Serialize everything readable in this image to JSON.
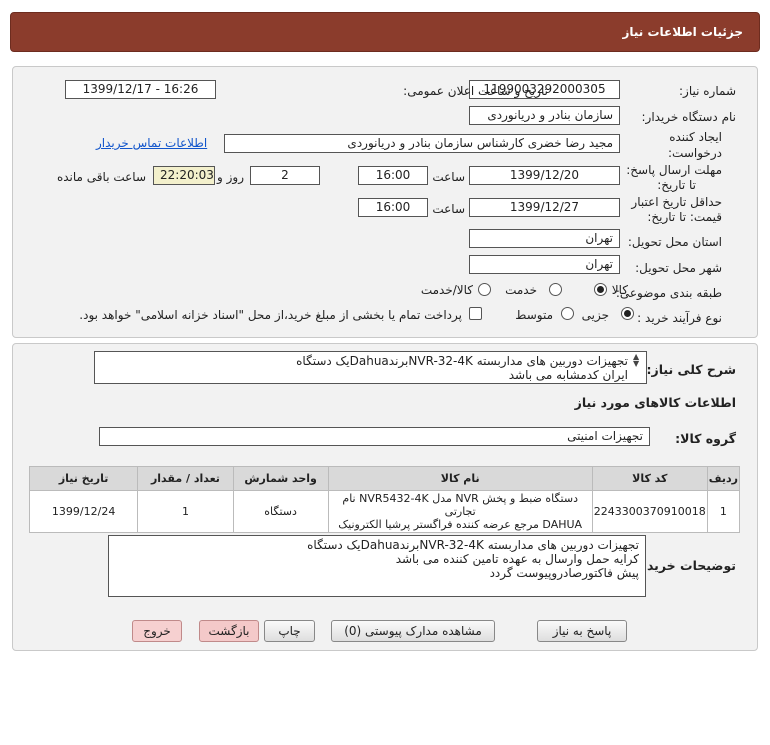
{
  "header": {
    "title": "جزئیات اطلاعات نیاز"
  },
  "info": {
    "need_number_label": "شماره نیاز:",
    "need_number": "1199003292000305",
    "announce_label": "تاریخ و ساعت اعلان عمومی:",
    "announce_value": "1399/12/17 - 16:26",
    "buyer_org_label": "نام دستگاه خریدار:",
    "buyer_org": "سازمان بنادر و دریانوردی",
    "creator_label_1": "ایجاد کننده",
    "creator_label_2": "درخواست:",
    "creator": "مجید رضا خضری کارشناس سازمان بنادر و دریانوردی",
    "contact_link": "اطلاعات تماس خریدار",
    "reply_deadline_label_1": "مهلت ارسال پاسخ:",
    "reply_deadline_label_2": "تا تاریخ:",
    "reply_date": "1399/12/20",
    "time_label": "ساعت",
    "reply_time": "16:00",
    "days_value": "2",
    "days_label": "روز و",
    "remaining_time": "22:20:03",
    "remaining_label": "ساعت باقی مانده",
    "validity_label_1": "حداقل تاریخ اعتبار",
    "validity_label_2": "قیمت: تا تاریخ:",
    "validity_date": "1399/12/27",
    "validity_time_label": "ساعت",
    "validity_time": "16:00",
    "province_label": "استان محل تحویل:",
    "province": "تهران",
    "city_label": "شهر محل تحویل:",
    "city": "تهران",
    "category_label": "طبقه بندی موضوعی:",
    "category_options": [
      "کالا",
      "خدمت",
      "کالا/خدمت"
    ],
    "category_selected": "کالا",
    "process_label": "نوع فرآیند خرید :",
    "process_options": [
      "جزیی",
      "متوسط"
    ],
    "process_selected": "جزیی",
    "payment_note": "پرداخت تمام یا بخشی از مبلغ خرید،از محل \"اسناد خزانه اسلامی\" خواهد بود."
  },
  "details": {
    "summary_label": "شرح کلی نیاز:",
    "summary_lines": [
      "تجهیزات دوربین های مداربسته NVR-32-4KبرندDahuaیک دستگاه",
      "ایران کدمشابه می باشد"
    ],
    "goods_info_title": "اطلاعات کالاهای مورد نیاز",
    "goods_group_label": "گروه کالا:",
    "goods_group": "تجهیزات امنیتی",
    "table": {
      "headers": [
        "ردیف",
        "کد کالا",
        "نام کالا",
        "واحد شمارش",
        "تعداد / مقدار",
        "تاریخ نیاز"
      ],
      "rows": [
        {
          "row": "1",
          "code": "2243300370910018",
          "name_line1": "دستگاه ضبط و پخش NVR مدل NVR5432-4K نام تجارتی",
          "name_line2": "DAHUA مرجع عرضه کننده فراگستر پرشیا الکترونیک",
          "unit": "دستگاه",
          "qty": "1",
          "date": "1399/12/24"
        }
      ]
    },
    "buyer_notes_label": "توضیحات خریدار:",
    "buyer_notes_lines": [
      "تجهیزات دوربین های مداربسته NVR-32-4KبرندDahuaیک دستگاه",
      "کرایه حمل وارسال به عهده تامین کننده می باشد",
      "پیش فاکتورصادروپیوست گردد"
    ]
  },
  "actions": {
    "reply": "پاسخ به نیاز",
    "view_docs": "مشاهده مدارک پیوستی (0)",
    "print": "چاپ",
    "back": "بازگشت",
    "exit": "خروج"
  }
}
